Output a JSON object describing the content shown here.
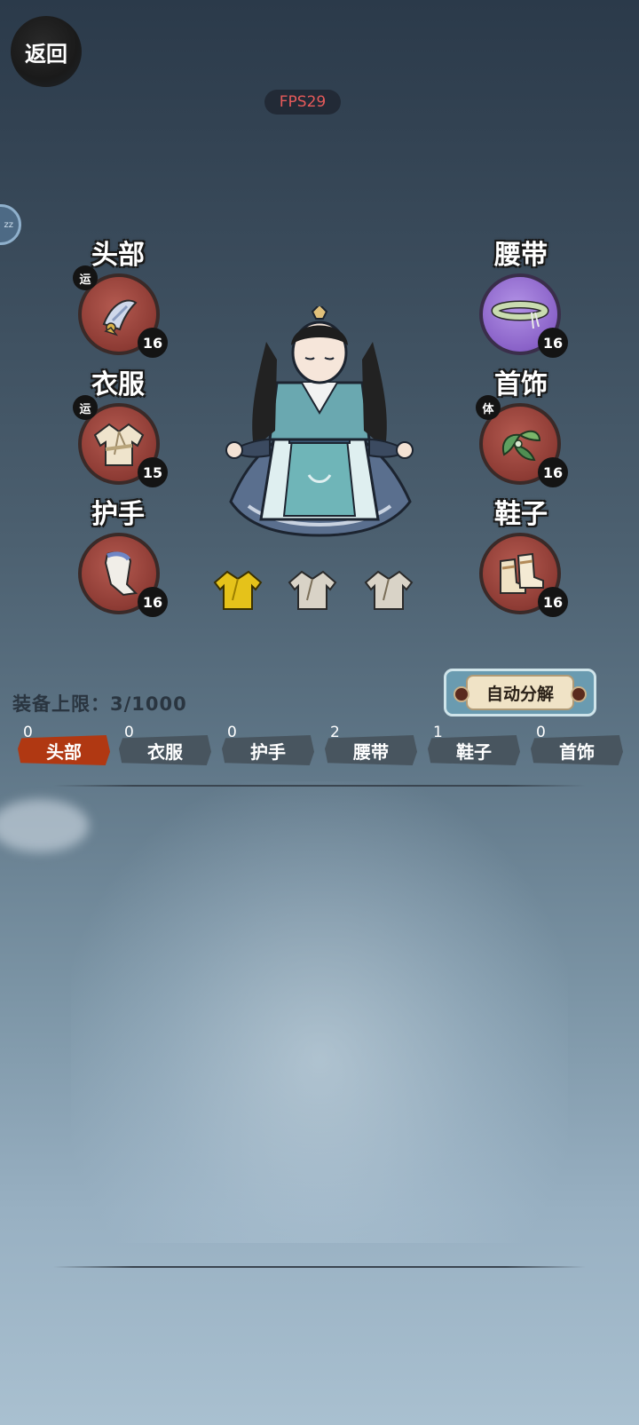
{
  "back_label": "返回",
  "fps_label": "FPS29",
  "side_bubble_label": "zz",
  "slots": [
    {
      "label": "头部",
      "level": "16",
      "tag": "运",
      "icon": "head-ornament-icon"
    },
    {
      "label": "衣服",
      "level": "15",
      "tag": "运",
      "icon": "robe-icon"
    },
    {
      "label": "护手",
      "level": "16",
      "tag": "",
      "icon": "bracer-icon"
    },
    {
      "label": "腰带",
      "level": "16",
      "tag": "",
      "icon": "belt-icon"
    },
    {
      "label": "首饰",
      "level": "16",
      "tag": "体",
      "icon": "jewelry-icon"
    },
    {
      "label": "鞋子",
      "level": "16",
      "tag": "",
      "icon": "boots-icon"
    }
  ],
  "limit_text": "装备上限：3/1000",
  "auto_button_label": "自动分解",
  "tabs": [
    {
      "label": "头部",
      "count": "0",
      "active": true
    },
    {
      "label": "衣服",
      "count": "0",
      "active": false
    },
    {
      "label": "护手",
      "count": "0",
      "active": false
    },
    {
      "label": "腰带",
      "count": "2",
      "active": false
    },
    {
      "label": "鞋子",
      "count": "1",
      "active": false
    },
    {
      "label": "首饰",
      "count": "0",
      "active": false
    }
  ],
  "colors": {
    "active_tab": "#b03812",
    "inactive_tab": "#48555f",
    "slot_red": "#8d3b34",
    "slot_purple": "#8a62c8",
    "fps_text": "#e65a5a"
  },
  "outfit_icons": [
    "gold-robe-icon",
    "grey-robe-icon",
    "grey-robe-icon"
  ]
}
